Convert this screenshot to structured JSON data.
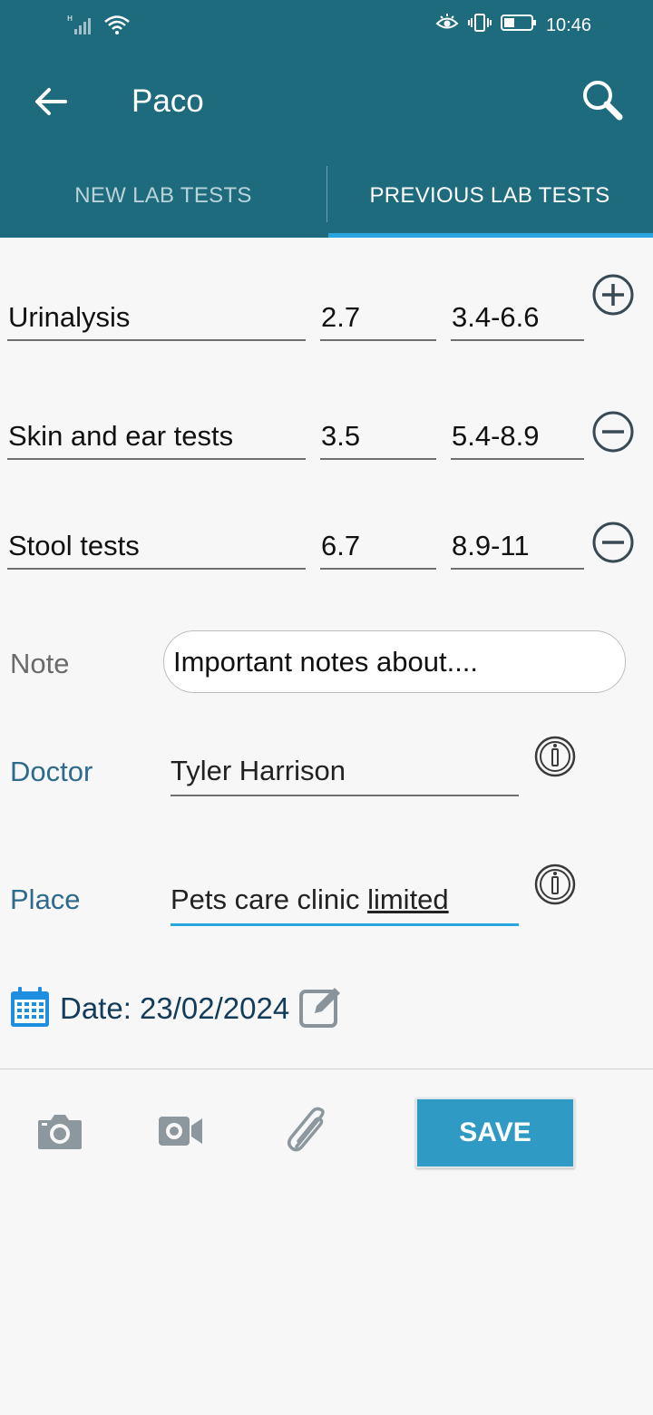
{
  "status_bar": {
    "time": "10:46",
    "network": "H"
  },
  "appbar": {
    "title": "Paco"
  },
  "tabs": [
    {
      "label": "NEW LAB TESTS",
      "active": false
    },
    {
      "label": "PREVIOUS LAB TESTS",
      "active": true
    }
  ],
  "lab_tests": [
    {
      "name": "Urinalysis",
      "value": "2.7",
      "range": "3.4-6.6",
      "action": "add"
    },
    {
      "name": "Skin and ear tests",
      "value": "3.5",
      "range": "5.4-8.9",
      "action": "remove"
    },
    {
      "name": "Stool tests",
      "value": "6.7",
      "range": "8.9-11",
      "action": "remove"
    }
  ],
  "note": {
    "label": "Note",
    "value": "Important notes about...."
  },
  "doctor": {
    "label": "Doctor",
    "value": "Tyler Harrison"
  },
  "place": {
    "label": "Place",
    "value_plain": "Pets care clinic ",
    "value_underlined": "limited"
  },
  "date": {
    "text": "Date: 23/02/2024"
  },
  "actions": {
    "save_label": "SAVE"
  },
  "colors": {
    "header": "#1e6b7d",
    "accent": "#2aa5e0",
    "save": "#2f9ac4",
    "label_blue": "#2e6a8c"
  }
}
